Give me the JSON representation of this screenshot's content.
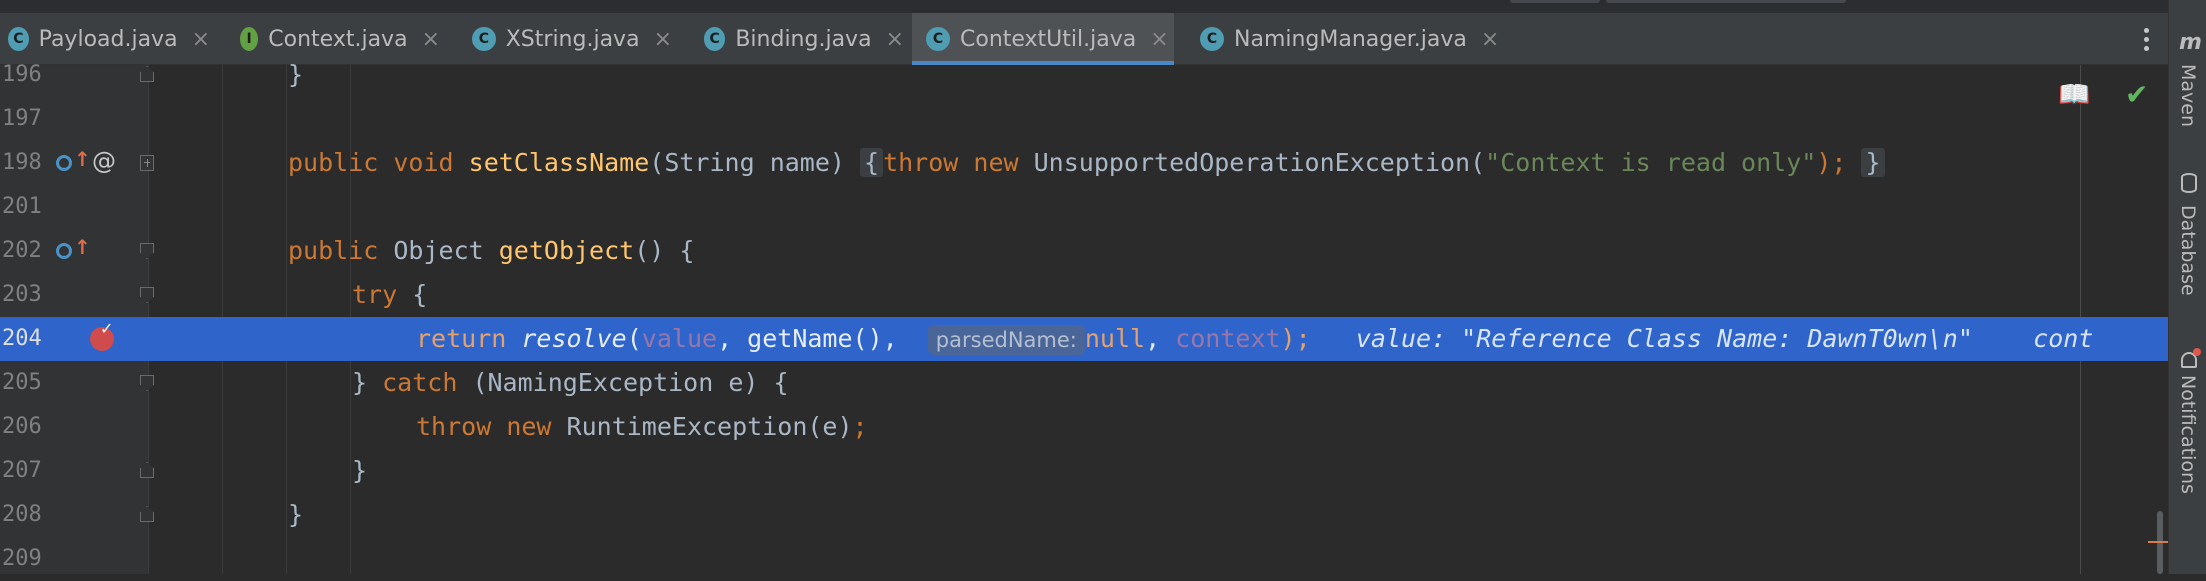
{
  "tabs": [
    {
      "label": "Payload.java",
      "icon": "C",
      "kind": "class-run"
    },
    {
      "label": "Context.java",
      "icon": "I",
      "kind": "interface"
    },
    {
      "label": "XString.java",
      "icon": "C",
      "kind": "class"
    },
    {
      "label": "Binding.java",
      "icon": "C",
      "kind": "class"
    },
    {
      "label": "ContextUtil.java",
      "icon": "C",
      "kind": "class",
      "active": true
    },
    {
      "label": "NamingManager.java",
      "icon": "C",
      "kind": "class"
    }
  ],
  "tab_close_glyph": "×",
  "right_tools": {
    "maven_glyph": "m",
    "maven": "Maven",
    "database": "Database",
    "notifications": "Notifications"
  },
  "lines": {
    "l196": {
      "no": "196",
      "brace": "}"
    },
    "l197": {
      "no": "197"
    },
    "l198": {
      "no": "198",
      "k1": "public",
      "k2": "void",
      "name": "setClassName",
      "sig": "(String name)",
      "open": "{",
      "k3": "throw",
      "k4": "new",
      "cls": "UnsupportedOperationException(",
      "str": "\"Context is read only\"",
      "end": ");",
      "close": "}"
    },
    "l201": {
      "no": "201"
    },
    "l202": {
      "no": "202",
      "k1": "public",
      "type": "Object",
      "name": "getObject",
      "rest": "() {"
    },
    "l203": {
      "no": "203",
      "k1": "try",
      "rest": "{"
    },
    "l204": {
      "no": "204",
      "k1": "return",
      "fn": "resolve",
      "p1": "value",
      "mid": ", getName(), ",
      "hint": "parsedName:",
      "nul": "null",
      "comma": ", ",
      "p2": "context",
      "end": ");",
      "inline": "value: \"Reference Class Name: DawnT0wn\\n\"",
      "inline2": "cont"
    },
    "l205": {
      "no": "205",
      "close": "}",
      "k1": "catch",
      "rest": "(NamingException e) {"
    },
    "l206": {
      "no": "206",
      "k1": "throw",
      "k2": "new",
      "rest": "RuntimeException(e)",
      "semi": ";"
    },
    "l207": {
      "no": "207",
      "close": "}"
    },
    "l208": {
      "no": "208",
      "close": "}"
    },
    "l209": {
      "no": "209"
    }
  },
  "icons": {
    "reader_mode": "book-icon",
    "inspection_ok": "checkmark-icon",
    "more": "kebab-icon",
    "implements": "implements-icon",
    "overrides": "override-arrow-icon",
    "annotation": "at-icon",
    "breakpoint": "breakpoint-icon"
  },
  "colors": {
    "keyword": "#cc7832",
    "method": "#ffc66d",
    "string": "#6a8759",
    "field": "#9876aa",
    "execution_line": "#2f65ca",
    "tab_underline": "#4a88c7"
  }
}
